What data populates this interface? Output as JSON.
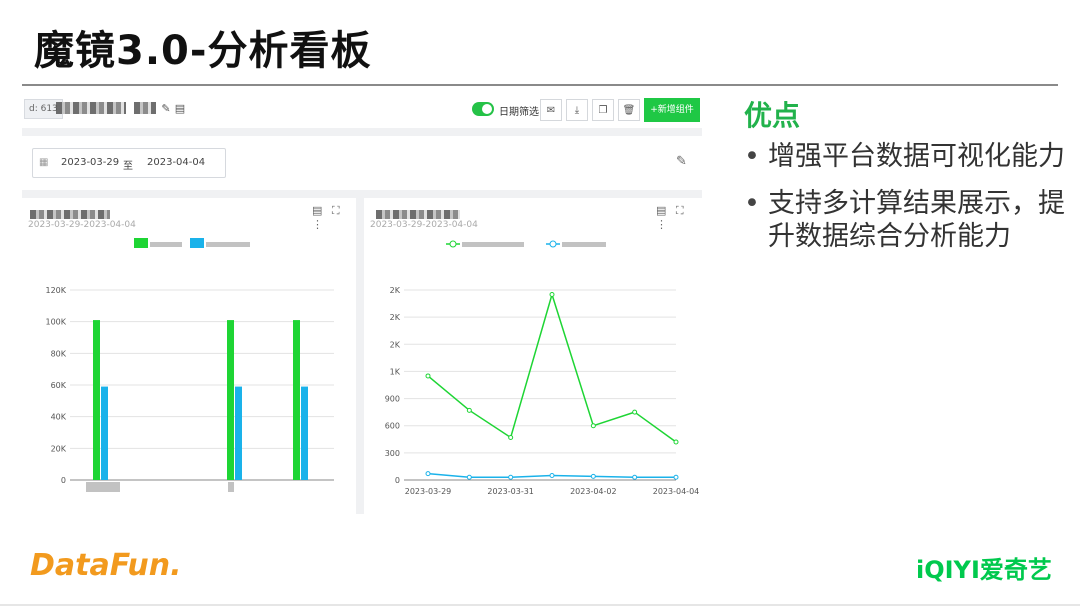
{
  "slide": {
    "title": "魔镜3.0-分析看板"
  },
  "screenshot": {
    "toolbar": {
      "id_label": "d: 613",
      "toggle_label": "日期筛选",
      "add_button_label": "+新增组件"
    },
    "date_filter": {
      "start": "2023-03-29",
      "separator": "至",
      "end": "2023-04-04"
    },
    "left_panel": {
      "date_range": "2023-03-29-2023-04-04"
    },
    "right_panel": {
      "date_range": "2023-03-29-2023-04-04"
    }
  },
  "chart_data": [
    {
      "type": "bar",
      "series_colors": [
        "#1ed534",
        "#1ab2ea"
      ],
      "series": [
        {
          "values": [
            101000,
            0,
            101000,
            101000
          ]
        },
        {
          "values": [
            59000,
            0,
            59000,
            59000
          ]
        }
      ],
      "y_ticks": [
        "120K",
        "100K",
        "80K",
        "60K",
        "40K",
        "20K",
        "0"
      ],
      "ylim": [
        0,
        120000
      ],
      "grid": true
    },
    {
      "type": "line",
      "series_colors": [
        "#1ed534",
        "#1ab2ea"
      ],
      "x": [
        "2023-03-29",
        "2023-03-30",
        "2023-03-31",
        "2023-04-01",
        "2023-04-02",
        "2023-04-03",
        "2023-04-04"
      ],
      "x_tick_labels": [
        "2023-03-29",
        "2023-03-31",
        "2023-04-02",
        "2023-04-04"
      ],
      "series": [
        {
          "values": [
            1150,
            770,
            470,
            2050,
            600,
            750,
            420
          ]
        },
        {
          "values": [
            70,
            30,
            30,
            50,
            40,
            30,
            30
          ]
        }
      ],
      "y_ticks": [
        "2K",
        "2K",
        "2K",
        "1K",
        "900",
        "600",
        "300",
        "0"
      ],
      "ylim": [
        0,
        2100
      ],
      "grid": true
    }
  ],
  "pros": {
    "title": "优点",
    "items": [
      "增强平台数据可视化能力",
      "支持多计算结果展示，提升数据综合分析能力"
    ]
  },
  "logos": {
    "left": "DataFun.",
    "right": "iQIYI爱奇艺"
  },
  "colors": {
    "accent_green": "#21b24b",
    "button_green": "#1fc845",
    "iqiyi_green": "#00c94d",
    "datafun_orange": "#f29a1e"
  }
}
